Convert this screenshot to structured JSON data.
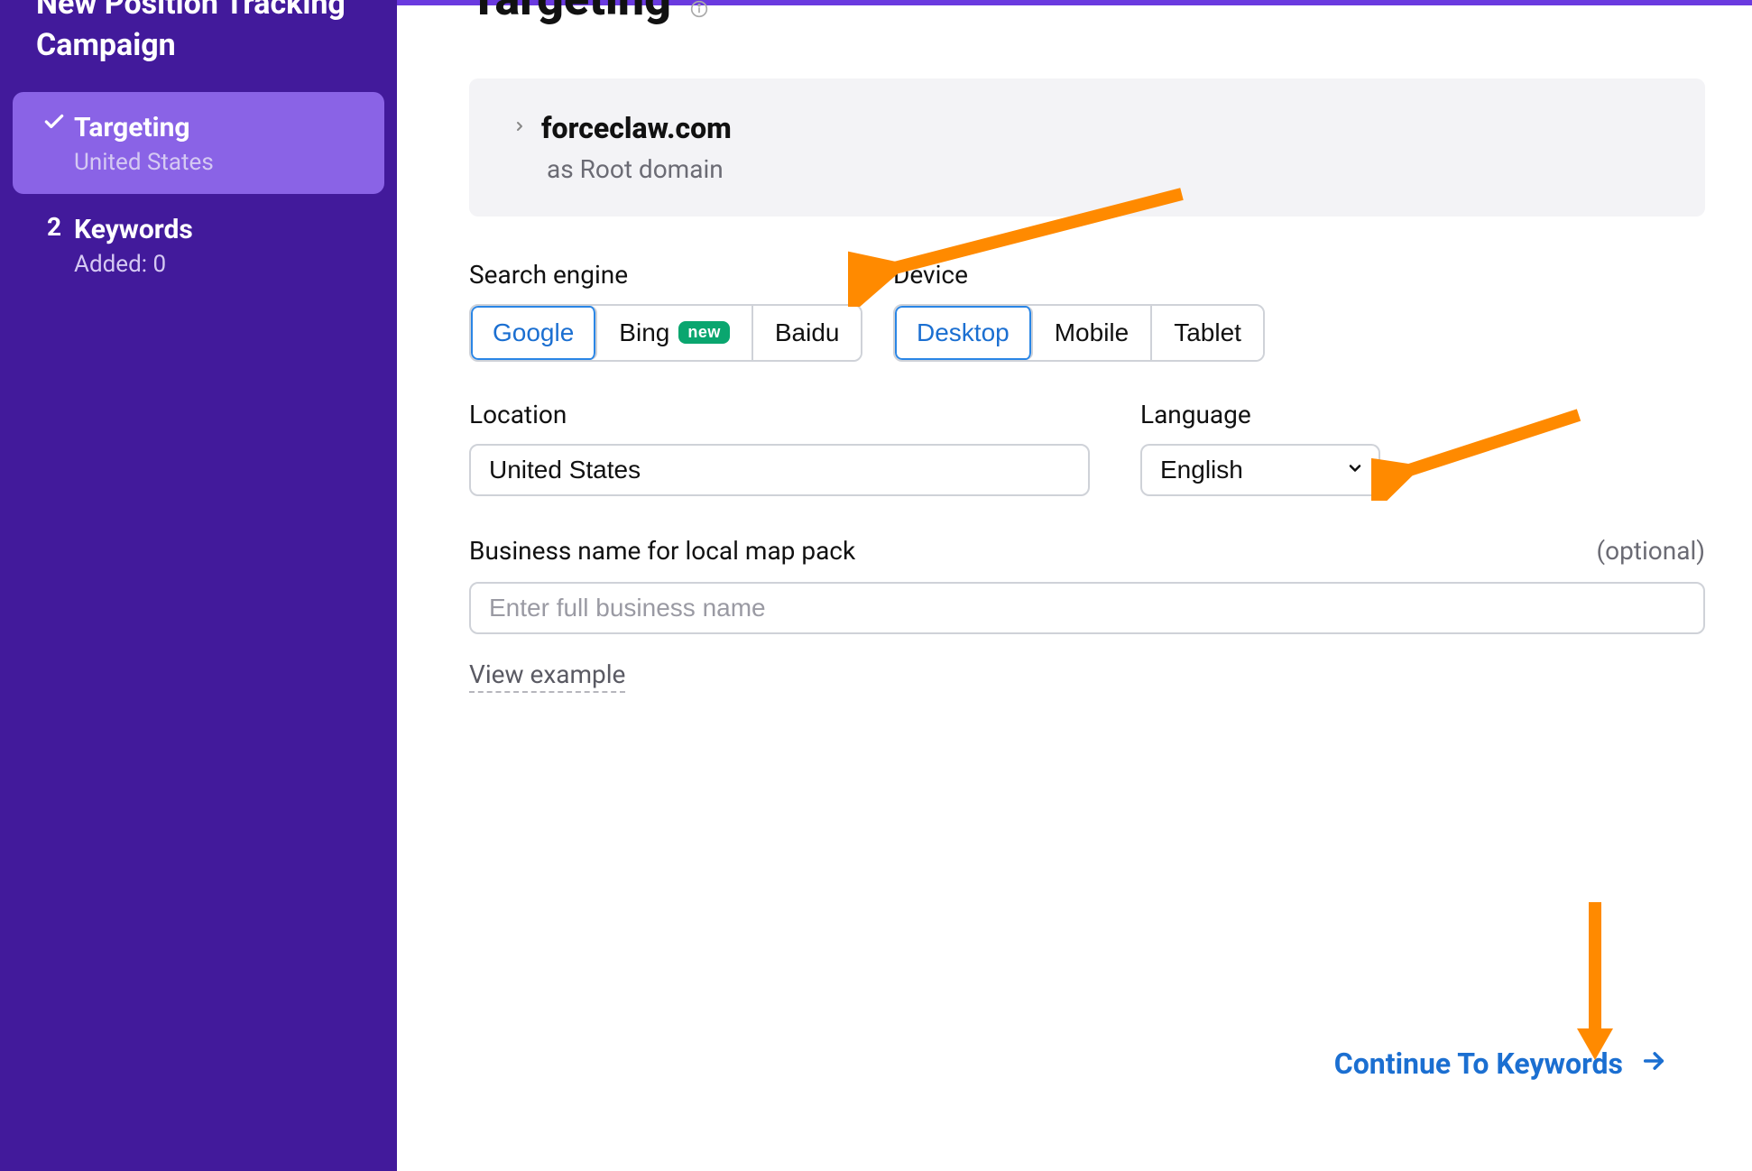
{
  "sidebar": {
    "title": "New Position Tracking Campaign",
    "steps": [
      {
        "label": "Targeting",
        "sub": "United States"
      },
      {
        "num": "2",
        "label": "Keywords",
        "sub": "Added: 0"
      }
    ]
  },
  "page": {
    "title": "Targeting"
  },
  "domain": {
    "name": "forceclaw.com",
    "sub": "as Root domain"
  },
  "labels": {
    "search_engine": "Search engine",
    "device": "Device",
    "location": "Location",
    "language": "Language",
    "business_name": "Business name for local map pack",
    "optional": "(optional)"
  },
  "search_engine": {
    "options": [
      "Google",
      "Bing",
      "Baidu"
    ],
    "selected": "Google",
    "new_badge": "new"
  },
  "device": {
    "options": [
      "Desktop",
      "Mobile",
      "Tablet"
    ],
    "selected": "Desktop"
  },
  "location": {
    "value": "United States"
  },
  "language": {
    "value": "English"
  },
  "business": {
    "placeholder": "Enter full business name",
    "view_example": "View example"
  },
  "continue": {
    "label": "Continue To Keywords"
  }
}
